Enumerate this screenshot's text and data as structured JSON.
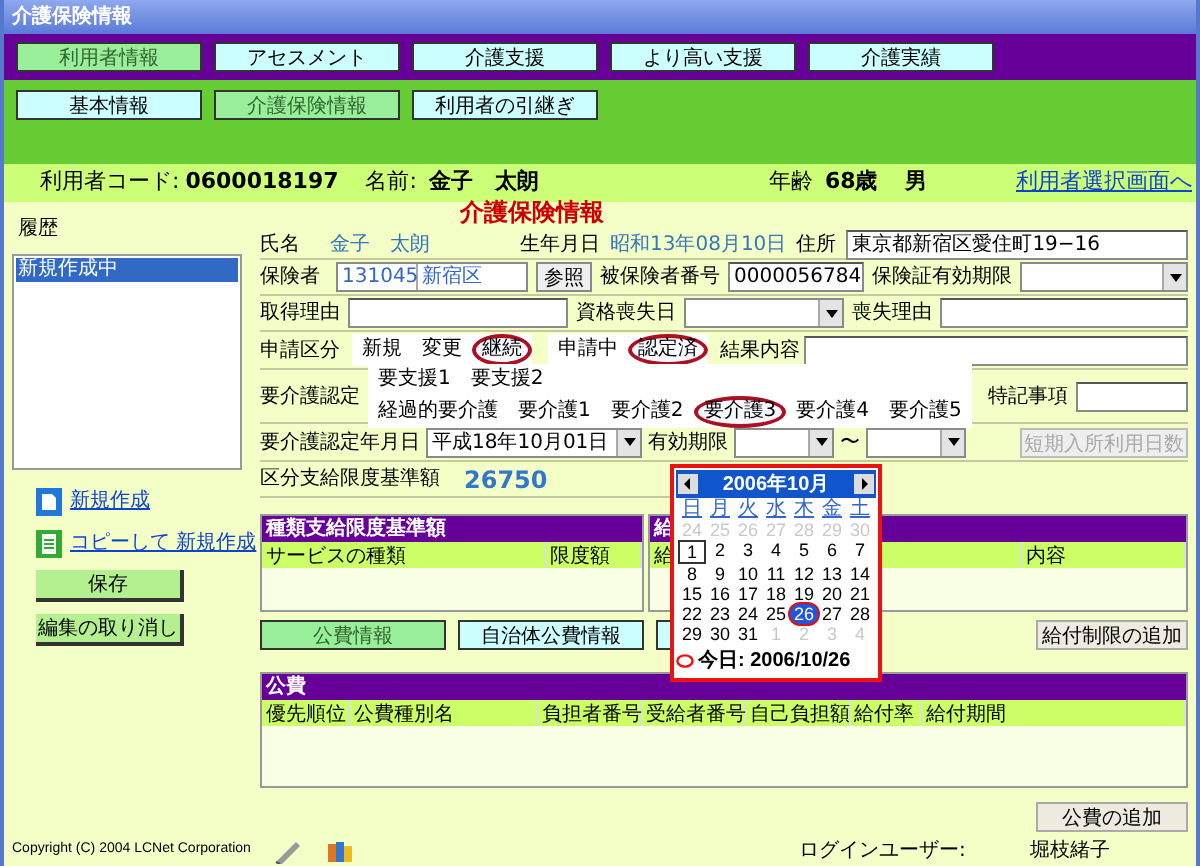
{
  "window": {
    "title": "介護保険情報"
  },
  "main_tabs": [
    {
      "label": "利用者情報",
      "selected": true
    },
    {
      "label": "アセスメント",
      "selected": false
    },
    {
      "label": "介護支援",
      "selected": false
    },
    {
      "label": "より高い支援",
      "selected": false
    },
    {
      "label": "介護実績",
      "selected": false
    }
  ],
  "sub_tabs": [
    {
      "label": "基本情報",
      "selected": false
    },
    {
      "label": "介護保険情報",
      "selected": true
    },
    {
      "label": "利用者の引継ぎ",
      "selected": false
    }
  ],
  "user_bar": {
    "code_label": "利用者コード:",
    "code": "0600018197",
    "name_label": "名前:",
    "name": "金子　太朗",
    "age_label": "年齢",
    "age": "68歳",
    "sex": "男",
    "link": "利用者選択画面へ"
  },
  "history": {
    "label": "履歴",
    "items": [
      {
        "label": "新規作成中",
        "selected": true
      }
    ]
  },
  "side_actions": [
    {
      "kind": "link",
      "label": "新規作成"
    },
    {
      "kind": "link",
      "label": "コピーして 新規作成"
    },
    {
      "kind": "button",
      "label": "保存"
    },
    {
      "kind": "button",
      "label": "編集の取り消し"
    }
  ],
  "form": {
    "title": "介護保険情報",
    "name": {
      "label": "氏名",
      "value": "金子　太朗"
    },
    "birth": {
      "label": "生年月日",
      "value": "昭和13年08月10日"
    },
    "address": {
      "label": "住所",
      "value": "東京都新宿区愛住町19−16"
    },
    "insurer": {
      "label": "保険者",
      "code": "131045",
      "name": "新宿区",
      "button": "参照"
    },
    "insured_no": {
      "label": "被保険者番号",
      "value": "0000056784"
    },
    "card_expiry": {
      "label": "保険証有効期限"
    },
    "acquire_reason": {
      "label": "取得理由"
    },
    "loss_date": {
      "label": "資格喪失日"
    },
    "loss_reason": {
      "label": "喪失理由"
    },
    "application": {
      "label": "申請区分",
      "types": [
        {
          "label": "新規",
          "selected": false
        },
        {
          "label": "変更",
          "selected": false
        },
        {
          "label": "継続",
          "selected": true
        }
      ],
      "statuses": [
        {
          "label": "申請中",
          "selected": false
        },
        {
          "label": "認定済",
          "selected": true
        }
      ]
    },
    "result": {
      "label": "結果内容"
    },
    "care_cert": {
      "label": "要介護認定",
      "support_levels": [
        {
          "label": "要支援1",
          "selected": false
        },
        {
          "label": "要支援2",
          "selected": false
        }
      ],
      "care_levels": [
        {
          "label": "経過的要介護",
          "selected": false
        },
        {
          "label": "要介護1",
          "selected": false
        },
        {
          "label": "要介護2",
          "selected": false
        },
        {
          "label": "要介護3",
          "selected": true
        },
        {
          "label": "要介護4",
          "selected": false
        },
        {
          "label": "要介護5",
          "selected": false
        }
      ]
    },
    "notes": {
      "label": "特記事項"
    },
    "cert_date": {
      "label": "要介護認定年月日",
      "value": "平成18年10月01日"
    },
    "validity": {
      "label": "有効期限",
      "separator": "〜"
    },
    "short_stay_button": {
      "label": "短期入所利用日数",
      "disabled": true
    },
    "limit": {
      "label": "区分支給限度基準額",
      "value": "26750"
    }
  },
  "calendar": {
    "month": "2006年10月",
    "weekdays": [
      "日",
      "月",
      "火",
      "水",
      "木",
      "金",
      "土"
    ],
    "days": [
      {
        "label": "24",
        "other_month": true,
        "selected": false,
        "focused": false
      },
      {
        "label": "25",
        "other_month": true,
        "selected": false,
        "focused": false
      },
      {
        "label": "26",
        "other_month": true,
        "selected": false,
        "focused": false
      },
      {
        "label": "27",
        "other_month": true,
        "selected": false,
        "focused": false
      },
      {
        "label": "28",
        "other_month": true,
        "selected": false,
        "focused": false
      },
      {
        "label": "29",
        "other_month": true,
        "selected": false,
        "focused": false
      },
      {
        "label": "30",
        "other_month": true,
        "selected": false,
        "focused": false
      },
      {
        "label": "1",
        "other_month": false,
        "selected": false,
        "focused": true
      },
      {
        "label": "2",
        "other_month": false,
        "selected": false,
        "focused": false
      },
      {
        "label": "3",
        "other_month": false,
        "selected": false,
        "focused": false
      },
      {
        "label": "4",
        "other_month": false,
        "selected": false,
        "focused": false
      },
      {
        "label": "5",
        "other_month": false,
        "selected": false,
        "focused": false
      },
      {
        "label": "6",
        "other_month": false,
        "selected": false,
        "focused": false
      },
      {
        "label": "7",
        "other_month": false,
        "selected": false,
        "focused": false
      },
      {
        "label": "8",
        "other_month": false,
        "selected": false,
        "focused": false
      },
      {
        "label": "9",
        "other_month": false,
        "selected": false,
        "focused": false
      },
      {
        "label": "10",
        "other_month": false,
        "selected": false,
        "focused": false
      },
      {
        "label": "11",
        "other_month": false,
        "selected": false,
        "focused": false
      },
      {
        "label": "12",
        "other_month": false,
        "selected": false,
        "focused": false
      },
      {
        "label": "13",
        "other_month": false,
        "selected": false,
        "focused": false
      },
      {
        "label": "14",
        "other_month": false,
        "selected": false,
        "focused": false
      },
      {
        "label": "15",
        "other_month": false,
        "selected": false,
        "focused": false
      },
      {
        "label": "16",
        "other_month": false,
        "selected": false,
        "focused": false
      },
      {
        "label": "17",
        "other_month": false,
        "selected": false,
        "focused": false
      },
      {
        "label": "18",
        "other_month": false,
        "selected": false,
        "focused": false
      },
      {
        "label": "19",
        "other_month": false,
        "selected": false,
        "focused": false
      },
      {
        "label": "20",
        "other_month": false,
        "selected": false,
        "focused": false
      },
      {
        "label": "21",
        "other_month": false,
        "selected": false,
        "focused": false
      },
      {
        "label": "22",
        "other_month": false,
        "selected": false,
        "focused": false
      },
      {
        "label": "23",
        "other_month": false,
        "selected": false,
        "focused": false
      },
      {
        "label": "24",
        "other_month": false,
        "selected": false,
        "focused": false
      },
      {
        "label": "25",
        "other_month": false,
        "selected": false,
        "focused": false
      },
      {
        "label": "26",
        "other_month": false,
        "selected": true,
        "focused": false
      },
      {
        "label": "27",
        "other_month": false,
        "selected": false,
        "focused": false
      },
      {
        "label": "28",
        "other_month": false,
        "selected": false,
        "focused": false
      },
      {
        "label": "29",
        "other_month": false,
        "selected": false,
        "focused": false
      },
      {
        "label": "30",
        "other_month": false,
        "selected": false,
        "focused": false
      },
      {
        "label": "31",
        "other_month": false,
        "selected": false,
        "focused": false
      },
      {
        "label": "1",
        "other_month": true,
        "selected": false,
        "focused": false
      },
      {
        "label": "2",
        "other_month": true,
        "selected": false,
        "focused": false
      },
      {
        "label": "3",
        "other_month": true,
        "selected": false,
        "focused": false
      },
      {
        "label": "4",
        "other_month": true,
        "selected": false,
        "focused": false
      }
    ],
    "today": "今日: 2006/10/26"
  },
  "service_limits": {
    "title": "種類支給限度基準額",
    "columns": [
      "サービスの種類",
      "限度額"
    ]
  },
  "benefit_limits": {
    "title": "給",
    "columns": [
      "給",
      "内容"
    ]
  },
  "info_tabs": [
    {
      "label": "公費情報",
      "selected": true
    },
    {
      "label": "自治体公費情報",
      "selected": false
    }
  ],
  "add_limit_button": "給付制限の追加",
  "public_expense": {
    "title": "公費",
    "columns": [
      "優先順位",
      "公費種別名",
      "負担者番号",
      "受給者番号",
      "自己負担額",
      "給付率",
      "給付期間"
    ]
  },
  "add_public_button": "公費の追加",
  "footer": {
    "copyright": "Copyright (C) 2004 LCNet Corporation",
    "login_label": "ログインユーザー:",
    "login_user": "堀枝緒子"
  }
}
